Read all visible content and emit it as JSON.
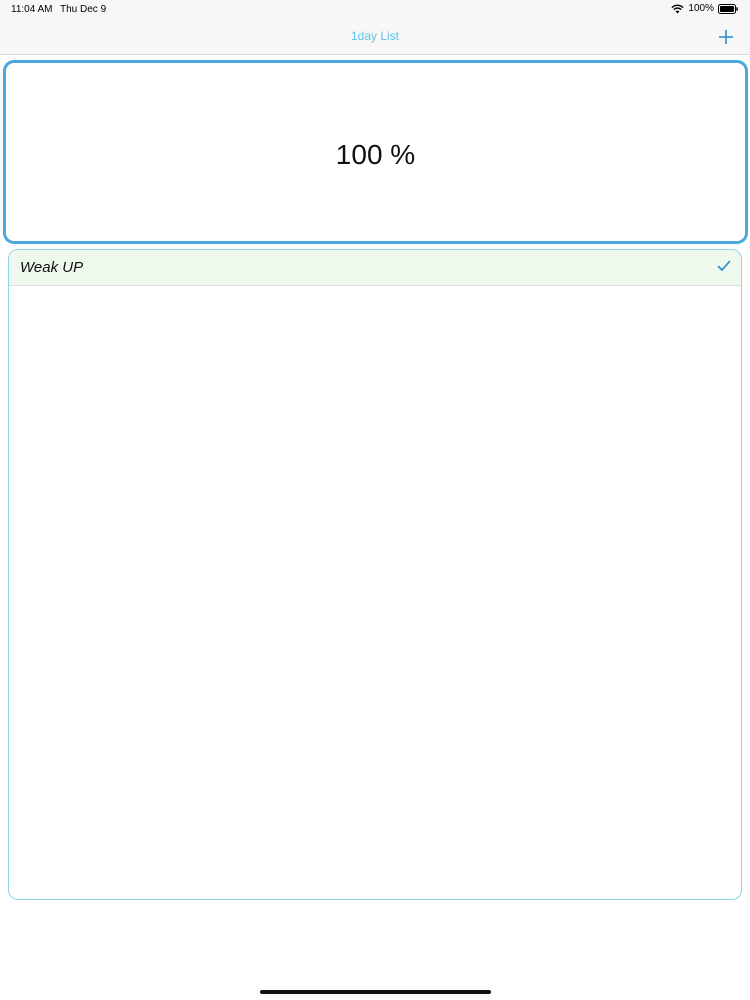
{
  "status_bar": {
    "time": "11:04 AM",
    "date": "Thu Dec 9",
    "battery": "100%",
    "icons": [
      "wifi-icon",
      "battery-icon"
    ]
  },
  "nav": {
    "title": "1day List",
    "add_icon": "plus-icon"
  },
  "progress": {
    "label": "100 %",
    "value": 100
  },
  "list": {
    "items": [
      {
        "label": "Weak UP",
        "checked": true,
        "check_icon": "checkmark-icon"
      }
    ]
  },
  "colors": {
    "accent": "#4aa8df",
    "title": "#5fc3e6",
    "list_border": "#8fd2ee",
    "row_checked_bg": "#eff8ec"
  }
}
